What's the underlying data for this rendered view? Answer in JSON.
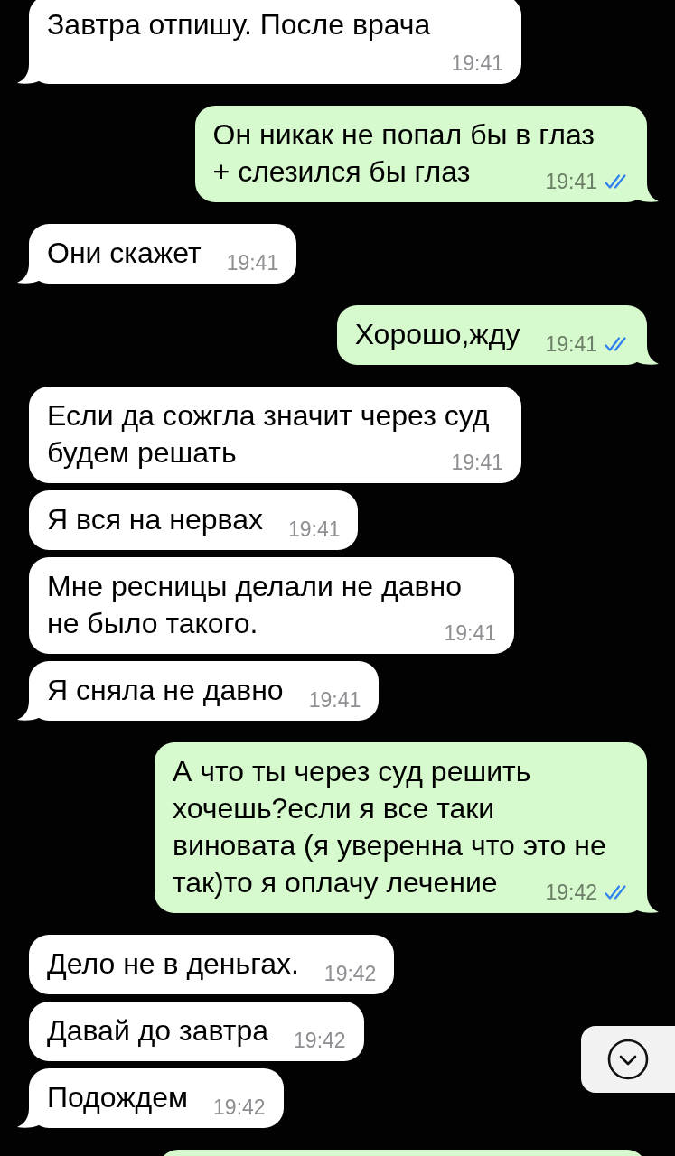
{
  "messages": [
    {
      "kind": "incoming",
      "lines": [
        "Завтра отпишу. После врача"
      ],
      "time": "19:41"
    },
    {
      "kind": "outgoing",
      "lines": [
        "Он никак не попал бы в глаз",
        "+ слезился бы глаз"
      ],
      "time": "19:41",
      "read": true
    },
    {
      "kind": "incoming",
      "lines": [
        "Они скажет"
      ],
      "time": "19:41"
    },
    {
      "kind": "outgoing",
      "lines": [
        "Хорошо,жду"
      ],
      "time": "19:41",
      "read": true
    },
    {
      "kind": "incoming",
      "lines": [
        "Если да сожгла значит через суд",
        "будем решать"
      ],
      "time": "19:41"
    },
    {
      "kind": "incoming",
      "lines": [
        "Я вся на нервах"
      ],
      "time": "19:41"
    },
    {
      "kind": "incoming",
      "lines": [
        "Мне ресницы делали не давно",
        "не было такого."
      ],
      "time": "19:41"
    },
    {
      "kind": "incoming",
      "lines": [
        "Я сняла не давно"
      ],
      "time": "19:41"
    },
    {
      "kind": "outgoing",
      "lines": [
        "А что ты через суд решить",
        "хочешь?если я все таки",
        "виновата (я уверенна что это не",
        "так)то я оплачу лечение"
      ],
      "time": "19:42",
      "read": true
    },
    {
      "kind": "incoming",
      "lines": [
        "Дело не в деньгах."
      ],
      "time": "19:42"
    },
    {
      "kind": "incoming",
      "lines": [
        "Давай до завтра"
      ],
      "time": "19:42"
    },
    {
      "kind": "incoming",
      "lines": [
        "Подождем"
      ],
      "time": "19:42"
    },
    {
      "kind": "outgoing"
    }
  ]
}
